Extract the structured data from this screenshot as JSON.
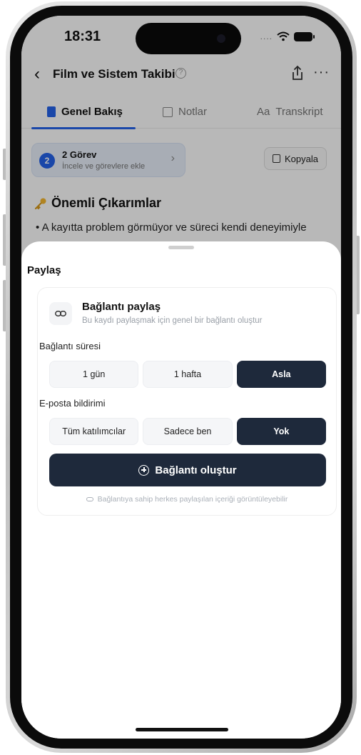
{
  "status_bar": {
    "time": "18:31",
    "signal_dots": "...."
  },
  "nav": {
    "back_glyph": "‹",
    "title": "Film ve Sistem Takibi",
    "help_glyph": "?",
    "more_glyph": "···"
  },
  "tabs": [
    {
      "label": "Genel Bakış",
      "active": true
    },
    {
      "label": "Notlar",
      "active": false
    },
    {
      "label": "Transkript",
      "prefix": "Aa",
      "active": false
    }
  ],
  "tasks": {
    "count": "2",
    "title": "2 Görev",
    "subtitle": "İncele ve görevlere ekle",
    "chevron": "›"
  },
  "copy_button": {
    "label": "Kopyala"
  },
  "section": {
    "title": "Önemli Çıkarımlar",
    "bullet": "• A kayıtta problem görmüyor ve süreci kendi deneyimiyle"
  },
  "sheet": {
    "title": "Paylaş",
    "link_share": {
      "title": "Bağlantı paylaş",
      "description": "Bu kaydı paylaşmak için genel bir bağlantı oluştur"
    },
    "duration": {
      "label": "Bağlantı süresi",
      "options": [
        "1 gün",
        "1 hafta",
        "Asla"
      ],
      "selected": "Asla"
    },
    "email": {
      "label": "E-posta bildirimi",
      "options": [
        "Tüm katılımcılar",
        "Sadece ben",
        "Yok"
      ],
      "selected": "Yok"
    },
    "create_button": "Bağlantı oluştur",
    "footnote": "Bağlantıya sahip herkes paylaşılan içeriği görüntüleyebilir"
  },
  "colors": {
    "accent": "#2563eb",
    "dark": "#1e293b"
  }
}
